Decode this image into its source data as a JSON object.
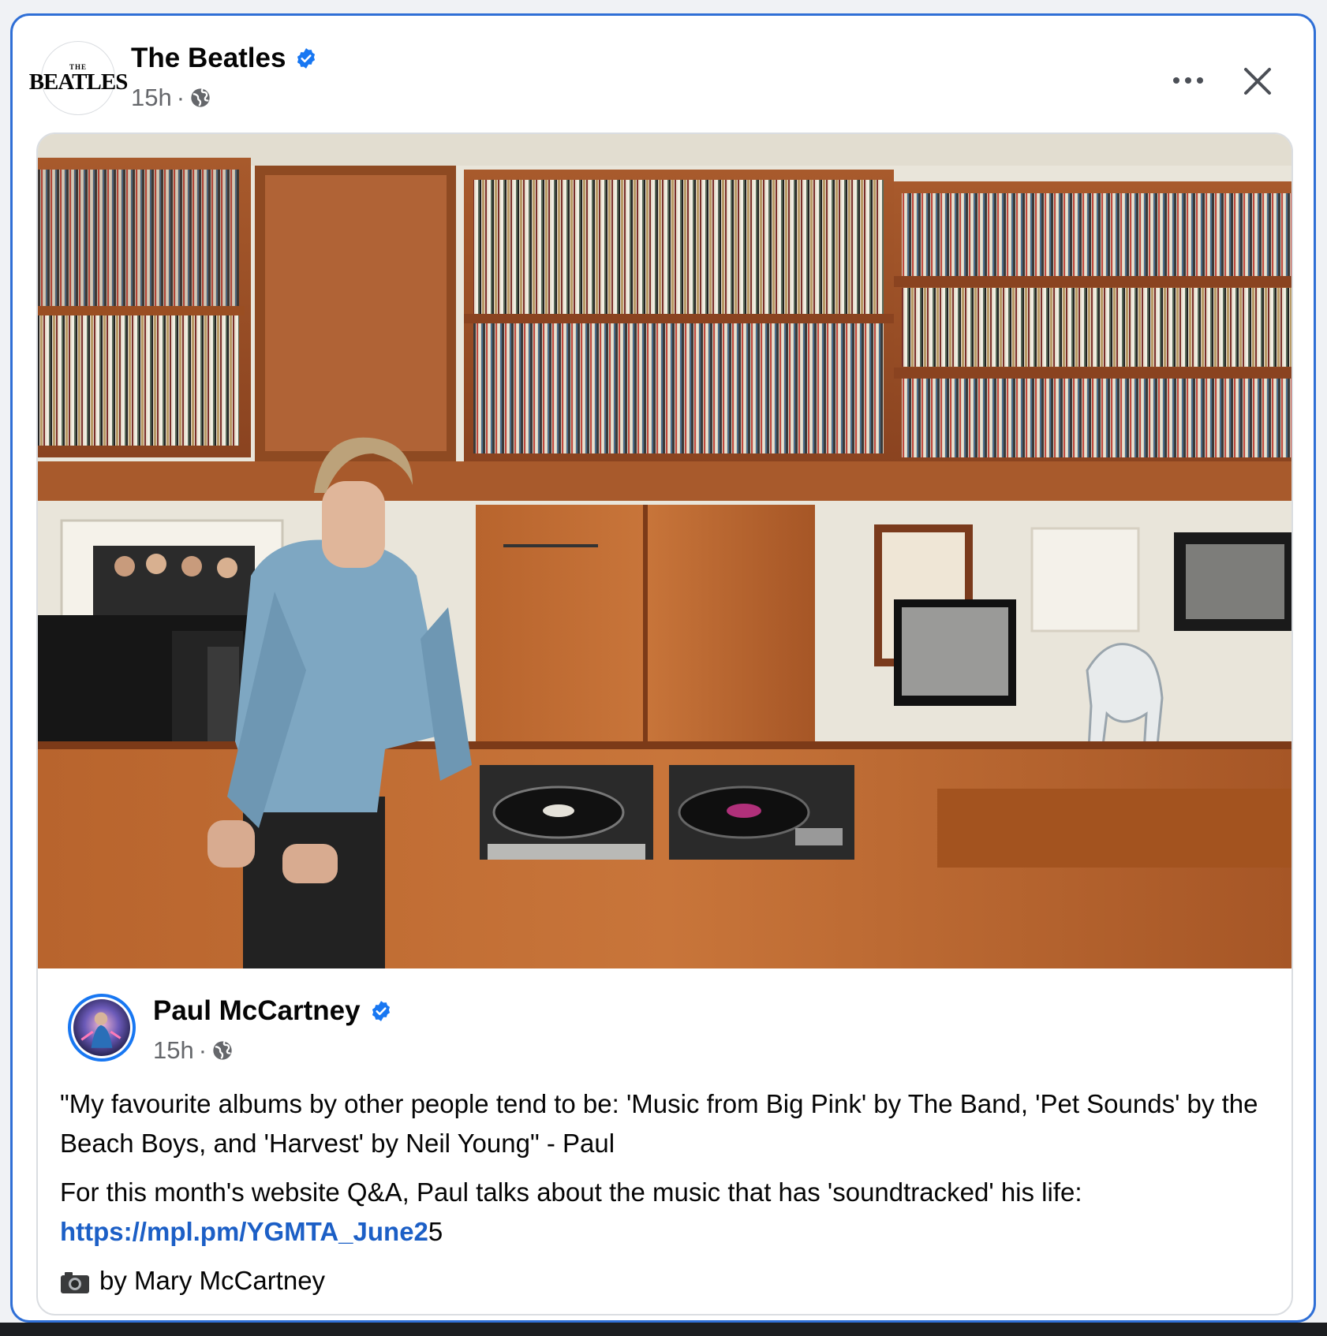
{
  "post": {
    "page_name": "The Beatles",
    "verified_icon": "verified-badge-icon",
    "logo_text_small": "THE",
    "logo_text_big": "BEATLES",
    "time": "15h",
    "separator": "·",
    "privacy_icon": "globe-icon",
    "more_icon": "more-options-icon",
    "close_icon": "close-icon"
  },
  "shared_post": {
    "photo_description_icon": "photo",
    "author": "Paul McCartney",
    "time": "15h",
    "separator": "·",
    "paragraph1": "\"My favourite albums by other people tend to be: 'Music from Big Pink' by The Band, 'Pet Sounds' by the Beach Boys, and 'Harvest' by Neil Young\" - Paul",
    "paragraph2_prefix": "For this month's website Q&A, Paul talks about the music that has 'soundtracked' his life:",
    "link_text": "https://mpl.pm/YGMTA_June2",
    "link_suffix": "5",
    "credit_icon": "camera-icon",
    "credit": "by Mary McCartney"
  },
  "colors": {
    "accent": "#1877f2",
    "link": "#1c5fc6",
    "border_focus": "#2f6fd6",
    "secondary_text": "#65676b"
  }
}
